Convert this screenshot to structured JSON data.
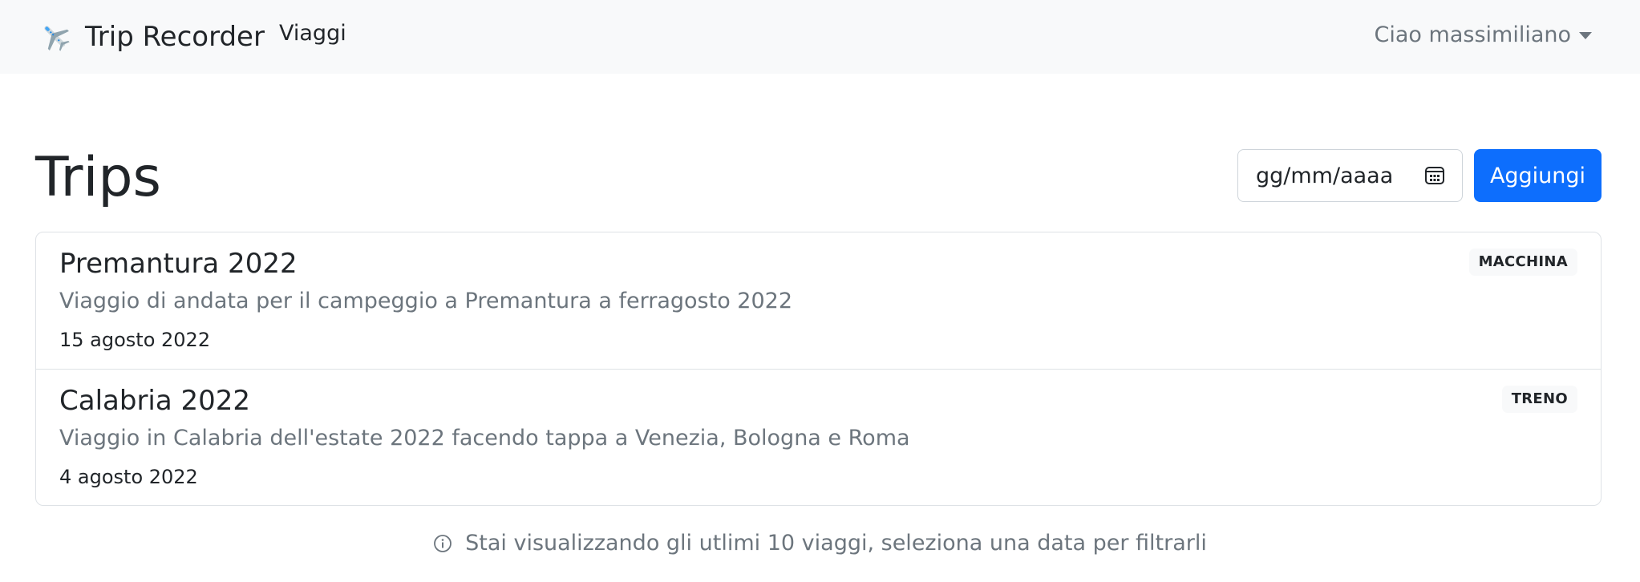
{
  "navbar": {
    "brand_icon": "airplane-icon",
    "brand_text": "Trip Recorder",
    "nav_link": "Viaggi",
    "user_greeting": "Ciao massimiliano"
  },
  "header": {
    "title": "Trips",
    "date_placeholder": "gg/mm/aaaa",
    "add_button": "Aggiungi"
  },
  "trips": [
    {
      "title": "Premantura 2022",
      "description": "Viaggio di andata per il campeggio a Premantura a ferragosto 2022",
      "date": "15 agosto 2022",
      "badge": "MACCHINA"
    },
    {
      "title": "Calabria 2022",
      "description": "Viaggio in Calabria dell'estate 2022 facendo tappa a Venezia, Bologna e Roma",
      "date": "4 agosto 2022",
      "badge": "TRENO"
    }
  ],
  "info_note": "Stai visualizzando gli utlimi 10 viaggi, seleziona una data per filtrarli",
  "colors": {
    "navbar_bg": "#f8f9fa",
    "primary": "#0d6efd",
    "muted": "#6c757d",
    "border": "#dee2e6"
  }
}
